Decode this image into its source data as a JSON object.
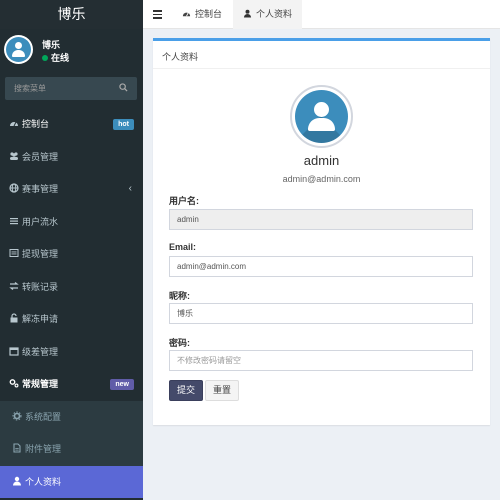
{
  "app": {
    "logo": "博乐"
  },
  "user": {
    "name": "博乐",
    "status": "在线",
    "status_color": "#00a65a"
  },
  "search": {
    "placeholder": "搜索菜单"
  },
  "menu": {
    "items": [
      {
        "label": "控制台",
        "icon": "dashboard-icon",
        "badge": "hot"
      },
      {
        "label": "会员管理",
        "icon": "users-icon"
      },
      {
        "label": "赛事管理",
        "icon": "globe-icon"
      },
      {
        "label": "用户流水",
        "icon": "list-icon"
      },
      {
        "label": "提现管理",
        "icon": "list-alt-icon"
      },
      {
        "label": "转账记录",
        "icon": "exchange-icon"
      },
      {
        "label": "解冻申请",
        "icon": "unlock-icon"
      },
      {
        "label": "级差管理",
        "icon": "calendar-icon"
      },
      {
        "label": "常规管理",
        "icon": "cogs-icon",
        "badge": "new"
      },
      {
        "label": "系统配置",
        "icon": "cog-icon"
      },
      {
        "label": "附件管理",
        "icon": "file-icon"
      },
      {
        "label": "个人资料",
        "icon": "user-icon"
      }
    ]
  },
  "topbar": {
    "tabs": [
      {
        "label": "控制台",
        "icon": "dashboard-icon"
      },
      {
        "label": "个人资料",
        "icon": "user-icon"
      }
    ]
  },
  "profile": {
    "box_title": "个人资料",
    "name": "admin",
    "email": "admin@admin.com",
    "form": {
      "username_label": "用户名:",
      "username_value": "admin",
      "email_label": "Email:",
      "email_value": "admin@admin.com",
      "nickname_label": "昵称:",
      "nickname_value": "博乐",
      "password_label": "密码:",
      "password_placeholder": "不修改密码请留空"
    },
    "submit_label": "提交",
    "reset_label": "重置"
  },
  "colors": {
    "sidebar_bg": "#222d32",
    "accent": "#3c8dbc",
    "active_menu": "#5b68d6",
    "badge_hot": "#3c8dbc",
    "badge_new": "#605ca8"
  }
}
